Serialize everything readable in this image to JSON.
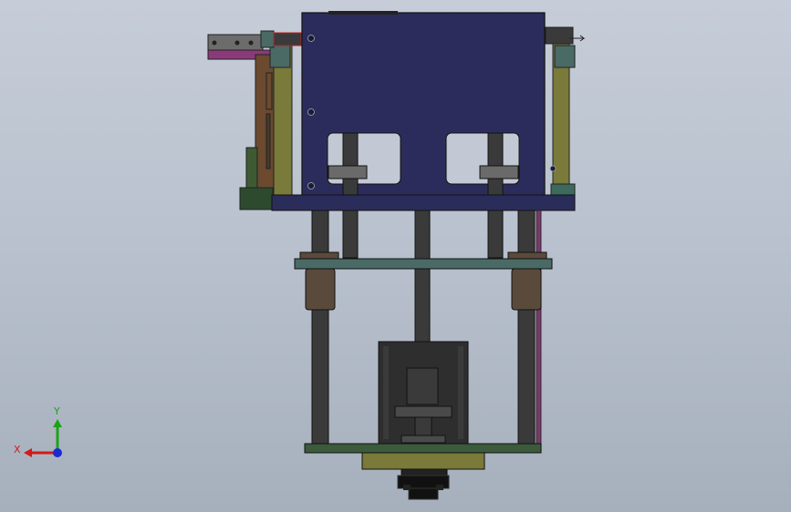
{
  "triad": {
    "x_label": "X",
    "y_label": "Y",
    "x_color": "#d11a1a",
    "y_color": "#1aa31a",
    "z_color": "#1a2ad1"
  },
  "colors": {
    "background_top": "#c6cdd8",
    "background_bottom": "#a6b0bc",
    "cover_box": "#2c2c5c",
    "base_plate": "#2a2d5a",
    "shaft": "#3a3a3a",
    "green_plate": "#3c5a3c",
    "teal_plate": "#4a6a66",
    "olive_frame": "#7a7a3a",
    "brown_rail": "#6b4a30",
    "magenta_bar": "#8a3a7a",
    "motor": "#2e2e2e",
    "bushing": "#5a4a3c"
  }
}
